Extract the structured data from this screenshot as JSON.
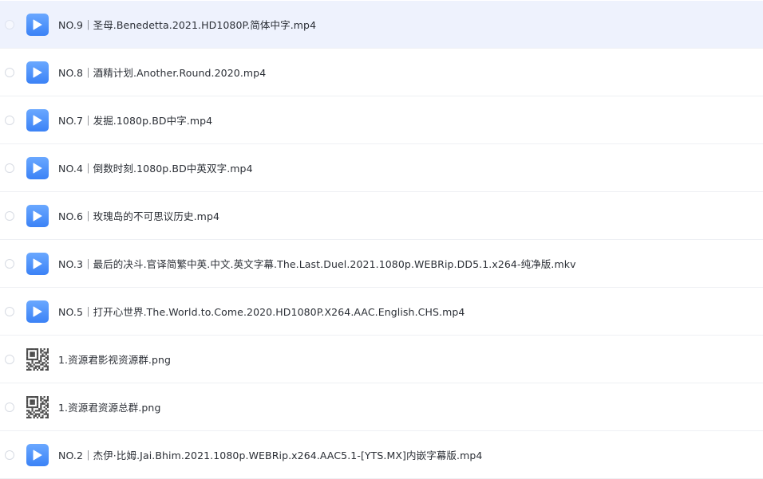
{
  "files": [
    {
      "type": "video",
      "icon": "play-video-icon",
      "name": "NO.9｜圣母.Benedetta.2021.HD1080P.简体中字.mp4",
      "selected": true
    },
    {
      "type": "video",
      "icon": "play-video-icon",
      "name": "NO.8｜酒精计划.Another.Round.2020.mp4",
      "selected": false
    },
    {
      "type": "video",
      "icon": "play-video-icon",
      "name": "NO.7｜发掘.1080p.BD中字.mp4",
      "selected": false
    },
    {
      "type": "video",
      "icon": "play-video-icon",
      "name": "NO.4｜倒数时刻.1080p.BD中英双字.mp4",
      "selected": false
    },
    {
      "type": "video",
      "icon": "play-video-icon",
      "name": "NO.6｜玫瑰岛的不可思议历史.mp4",
      "selected": false
    },
    {
      "type": "video",
      "icon": "play-video-icon",
      "name": "NO.3｜最后的决斗.官译简繁中英.中文.英文字幕.The.Last.Duel.2021.1080p.WEBRip.DD5.1.x264-纯净版.mkv",
      "selected": false
    },
    {
      "type": "video",
      "icon": "play-video-icon",
      "name": "NO.5｜打开心世界.The.World.to.Come.2020.HD1080P.X264.AAC.English.CHS.mp4",
      "selected": false
    },
    {
      "type": "image",
      "icon": "qr-code-image-icon",
      "name": "1.资源君影视资源群.png",
      "selected": false
    },
    {
      "type": "image",
      "icon": "qr-code-image-icon",
      "name": "1.资源君资源总群.png",
      "selected": false
    },
    {
      "type": "video",
      "icon": "play-video-icon",
      "name": "NO.2｜杰伊·比姆.Jai.Bhim.2021.1080p.WEBRip.x264.AAC5.1-[YTS.MX]内嵌字幕版.mp4",
      "selected": false
    }
  ],
  "colors": {
    "selected_row": "#eef2fd",
    "video_icon": "#3b82f6",
    "text": "#2b2f36",
    "divider": "#eef0f4"
  }
}
